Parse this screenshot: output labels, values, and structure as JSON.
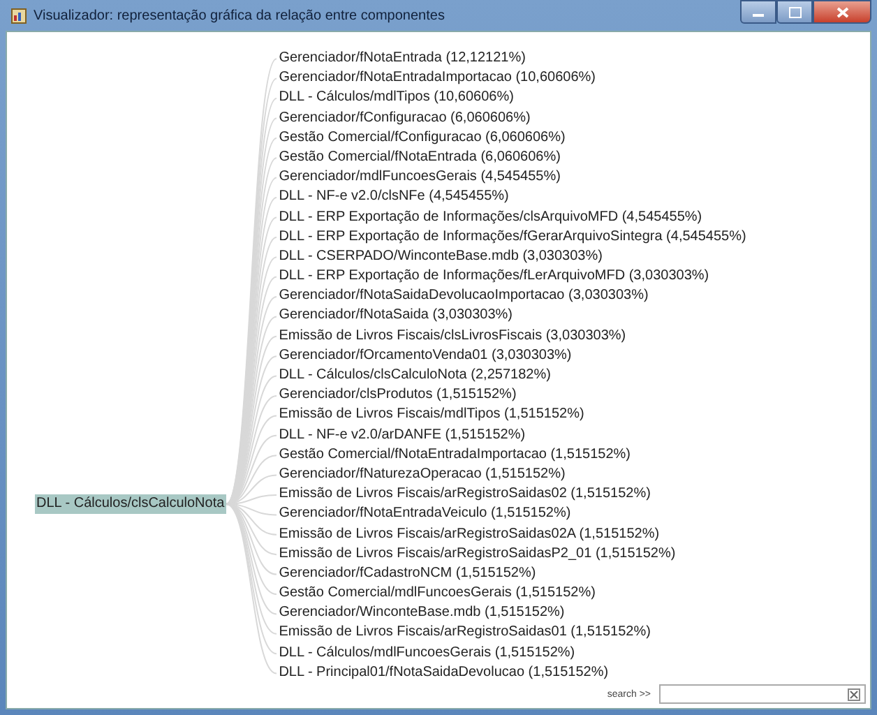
{
  "window": {
    "title": "Visualizador: representação gráfica da relação entre componentes"
  },
  "root": {
    "label": "DLL - Cálculos/clsCalculoNota",
    "selected": true
  },
  "items": [
    {
      "label": "Gerenciador/fNotaEntrada (12,12121%)"
    },
    {
      "label": "Gerenciador/fNotaEntradaImportacao (10,60606%)"
    },
    {
      "label": "DLL - Cálculos/mdlTipos (10,60606%)"
    },
    {
      "label": "Gerenciador/fConfiguracao (6,060606%)"
    },
    {
      "label": "Gestão Comercial/fConfiguracao (6,060606%)"
    },
    {
      "label": "Gestão Comercial/fNotaEntrada (6,060606%)"
    },
    {
      "label": "Gerenciador/mdlFuncoesGerais (4,545455%)"
    },
    {
      "label": "DLL - NF-e v2.0/clsNFe (4,545455%)"
    },
    {
      "label": "DLL - ERP Exportação de Informações/clsArquivoMFD (4,545455%)"
    },
    {
      "label": "DLL - ERP Exportação de Informações/fGerarArquivoSintegra (4,545455%)"
    },
    {
      "label": "DLL - CSERPADO/WinconteBase.mdb (3,030303%)"
    },
    {
      "label": "DLL - ERP Exportação de Informações/fLerArquivoMFD (3,030303%)"
    },
    {
      "label": "Gerenciador/fNotaSaidaDevolucaoImportacao (3,030303%)"
    },
    {
      "label": "Gerenciador/fNotaSaida (3,030303%)"
    },
    {
      "label": "Emissão de Livros Fiscais/clsLivrosFiscais (3,030303%)"
    },
    {
      "label": "Gerenciador/fOrcamentoVenda01 (3,030303%)"
    },
    {
      "label": "DLL - Cálculos/clsCalculoNota (2,257182%)"
    },
    {
      "label": "Gerenciador/clsProdutos (1,515152%)"
    },
    {
      "label": "Emissão de Livros Fiscais/mdlTipos (1,515152%)"
    },
    {
      "label": "DLL - NF-e v2.0/arDANFE (1,515152%)"
    },
    {
      "label": "Gestão Comercial/fNotaEntradaImportacao (1,515152%)"
    },
    {
      "label": "Gerenciador/fNaturezaOperacao (1,515152%)"
    },
    {
      "label": "Emissão de Livros Fiscais/arRegistroSaidas02 (1,515152%)"
    },
    {
      "label": "Gerenciador/fNotaEntradaVeiculo (1,515152%)"
    },
    {
      "label": "Emissão de Livros Fiscais/arRegistroSaidas02A (1,515152%)"
    },
    {
      "label": "Emissão de Livros Fiscais/arRegistroSaidasP2_01 (1,515152%)"
    },
    {
      "label": "Gerenciador/fCadastroNCM (1,515152%)"
    },
    {
      "label": "Gestão Comercial/mdlFuncoesGerais (1,515152%)"
    },
    {
      "label": "Gerenciador/WinconteBase.mdb (1,515152%)"
    },
    {
      "label": "Emissão de Livros Fiscais/arRegistroSaidas01 (1,515152%)"
    },
    {
      "label": "DLL - Cálculos/mdlFuncoesGerais (1,515152%)"
    },
    {
      "label": "DLL - Principal01/fNotaSaidaDevolucao (1,515152%)"
    }
  ],
  "search": {
    "label": "search >>"
  }
}
